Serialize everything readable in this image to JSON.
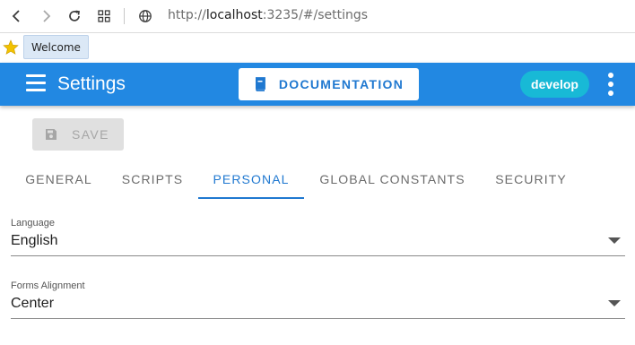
{
  "browser": {
    "url_prefix": "http://",
    "url_host": "localhost",
    "url_rest": ":3235/#/settings",
    "bookmark_label": "Welcome"
  },
  "app_bar": {
    "title": "Settings",
    "doc_button_label": "DOCUMENTATION",
    "branch_chip": "develop",
    "colors": {
      "bar": "#2288e2",
      "chip": "#18b9d6"
    }
  },
  "toolbar": {
    "save_label": "SAVE"
  },
  "tabs": [
    {
      "label": "GENERAL",
      "active": false
    },
    {
      "label": "SCRIPTS",
      "active": false
    },
    {
      "label": "PERSONAL",
      "active": true
    },
    {
      "label": "GLOBAL CONSTANTS",
      "active": false
    },
    {
      "label": "SECURITY",
      "active": false
    }
  ],
  "fields": {
    "language": {
      "label": "Language",
      "value": "English"
    },
    "forms_alignment": {
      "label": "Forms Alignment",
      "value": "Center"
    }
  },
  "icons": [
    "back-icon",
    "forward-icon",
    "reload-icon",
    "apps-icon",
    "site-info-icon",
    "bookmark-star-icon",
    "menu-icon",
    "book-icon",
    "save-icon",
    "more-vert-icon",
    "dropdown-arrow-icon"
  ]
}
